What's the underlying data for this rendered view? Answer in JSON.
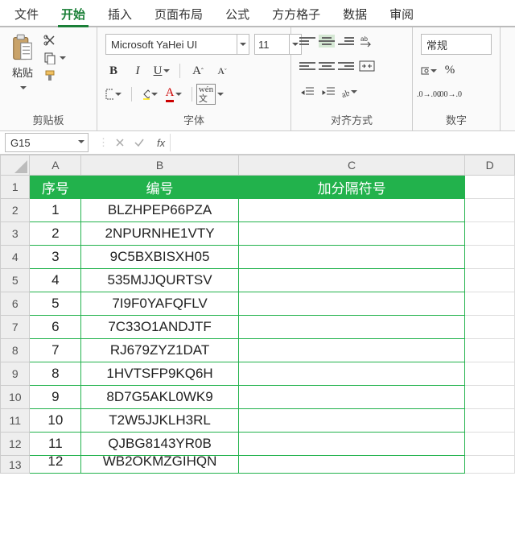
{
  "menu": {
    "items": [
      "文件",
      "开始",
      "插入",
      "页面布局",
      "公式",
      "方方格子",
      "数据",
      "审阅"
    ],
    "active": 1
  },
  "ribbon": {
    "clipboard": {
      "title": "剪贴板",
      "paste": "粘贴"
    },
    "font": {
      "title": "字体",
      "name": "Microsoft YaHei UI",
      "size": "11",
      "wen": "wén",
      "wen2": "文"
    },
    "align": {
      "title": "对齐方式"
    },
    "number": {
      "title": "数字",
      "format": "常规"
    }
  },
  "formula_bar": {
    "cell_ref": "G15",
    "fx": "fx",
    "value": ""
  },
  "sheet": {
    "col_letters": [
      "A",
      "B",
      "C",
      "D"
    ],
    "headers": {
      "A": "序号",
      "B": "编号",
      "C": "加分隔符号"
    },
    "rows": [
      {
        "n": "1",
        "a": "1",
        "b": "BLZHPEP66PZA",
        "c": ""
      },
      {
        "n": "2",
        "a": "2",
        "b": "2NPURNHE1VTY",
        "c": ""
      },
      {
        "n": "3",
        "a": "3",
        "b": "9C5BXBISXH05",
        "c": ""
      },
      {
        "n": "4",
        "a": "4",
        "b": "535MJJQURTSV",
        "c": ""
      },
      {
        "n": "5",
        "a": "5",
        "b": "7I9F0YAFQFLV",
        "c": ""
      },
      {
        "n": "6",
        "a": "6",
        "b": "7C33O1ANDJTF",
        "c": ""
      },
      {
        "n": "7",
        "a": "7",
        "b": "RJ679ZYZ1DAT",
        "c": ""
      },
      {
        "n": "8",
        "a": "8",
        "b": "1HVTSFP9KQ6H",
        "c": ""
      },
      {
        "n": "9",
        "a": "9",
        "b": "8D7G5AKL0WK9",
        "c": ""
      },
      {
        "n": "10",
        "a": "10",
        "b": "T2W5JJKLH3RL",
        "c": ""
      },
      {
        "n": "11",
        "a": "11",
        "b": "QJBG8143YR0B",
        "c": ""
      },
      {
        "n": "12",
        "a": "12",
        "b": "WB2OKMZGIHQN",
        "c": ""
      }
    ]
  }
}
